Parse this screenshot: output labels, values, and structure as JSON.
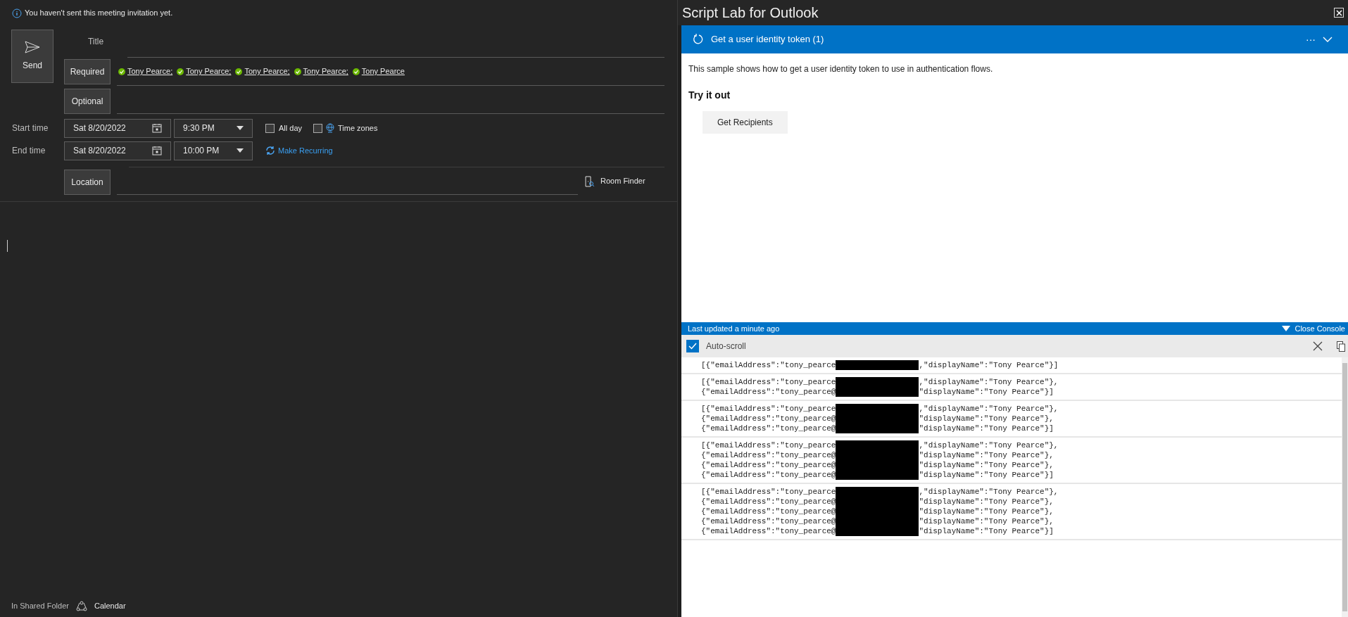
{
  "notice": {
    "text": "You haven't sent this meeting invitation yet."
  },
  "send_button": {
    "label": "Send"
  },
  "title_field": {
    "label": "Title"
  },
  "required": {
    "button": "Required",
    "attendees": [
      {
        "name": "Tony Pearce;"
      },
      {
        "name": "Tony Pearce;"
      },
      {
        "name": "Tony Pearce;"
      },
      {
        "name": "Tony Pearce;"
      },
      {
        "name": "Tony Pearce"
      }
    ]
  },
  "optional": {
    "button": "Optional"
  },
  "start": {
    "label": "Start time",
    "date": "Sat 8/20/2022",
    "time": "9:30 PM"
  },
  "end": {
    "label": "End time",
    "date": "Sat 8/20/2022",
    "time": "10:00 PM"
  },
  "all_day": {
    "label": "All day",
    "checked": false
  },
  "time_zones": {
    "label": "Time zones",
    "checked": false
  },
  "make_recurring": {
    "label": "Make Recurring"
  },
  "location": {
    "button": "Location"
  },
  "room_finder": {
    "label": "Room Finder"
  },
  "footer": {
    "folder": "In Shared Folder",
    "calendar": "Calendar"
  },
  "pane": {
    "title": "Script Lab for Outlook",
    "snippet_title": "Get a user identity token (1)",
    "more": "···",
    "description": "This sample shows how to get a user identity token to use in authentication flows.",
    "heading": "Try it out",
    "button": "Get Recipients"
  },
  "console": {
    "status": "Last updated a minute ago",
    "close": "Close Console",
    "auto_scroll": {
      "label": "Auto-scroll",
      "checked": true
    },
    "entries": [
      {
        "lines": [
          {
            "before": "[{\"emailAddress\":\"tony_pearce",
            "after": ",\"displayName\":\"Tony Pearce\"}]"
          }
        ]
      },
      {
        "lines": [
          {
            "before": "[{\"emailAddress\":\"tony_pearce",
            "after": ",\"displayName\":\"Tony Pearce\"},"
          },
          {
            "before": "{\"emailAddress\":\"tony_pearce@",
            "after": "\"displayName\":\"Tony Pearce\"}]"
          }
        ]
      },
      {
        "lines": [
          {
            "before": "[{\"emailAddress\":\"tony_pearce",
            "after": ",\"displayName\":\"Tony Pearce\"},"
          },
          {
            "before": "{\"emailAddress\":\"tony_pearce@",
            "after": "\"displayName\":\"Tony Pearce\"},"
          },
          {
            "before": "{\"emailAddress\":\"tony_pearce@",
            "after": "\"displayName\":\"Tony Pearce\"}]"
          }
        ]
      },
      {
        "lines": [
          {
            "before": "[{\"emailAddress\":\"tony_pearce",
            "after": ",\"displayName\":\"Tony Pearce\"},"
          },
          {
            "before": "{\"emailAddress\":\"tony_pearce@",
            "after": "\"displayName\":\"Tony Pearce\"},"
          },
          {
            "before": "{\"emailAddress\":\"tony_pearce@",
            "after": "\"displayName\":\"Tony Pearce\"},"
          },
          {
            "before": "{\"emailAddress\":\"tony_pearce@",
            "after": "\"displayName\":\"Tony Pearce\"}]"
          }
        ]
      },
      {
        "lines": [
          {
            "before": "[{\"emailAddress\":\"tony_pearce",
            "after": ",\"displayName\":\"Tony Pearce\"},"
          },
          {
            "before": "{\"emailAddress\":\"tony_pearce@",
            "after": "\"displayName\":\"Tony Pearce\"},"
          },
          {
            "before": "{\"emailAddress\":\"tony_pearce@",
            "after": "\"displayName\":\"Tony Pearce\"},"
          },
          {
            "before": "{\"emailAddress\":\"tony_pearce@",
            "after": "\"displayName\":\"Tony Pearce\"},"
          },
          {
            "before": "{\"emailAddress\":\"tony_pearce@",
            "after": "\"displayName\":\"Tony Pearce\"}]"
          }
        ]
      }
    ]
  }
}
